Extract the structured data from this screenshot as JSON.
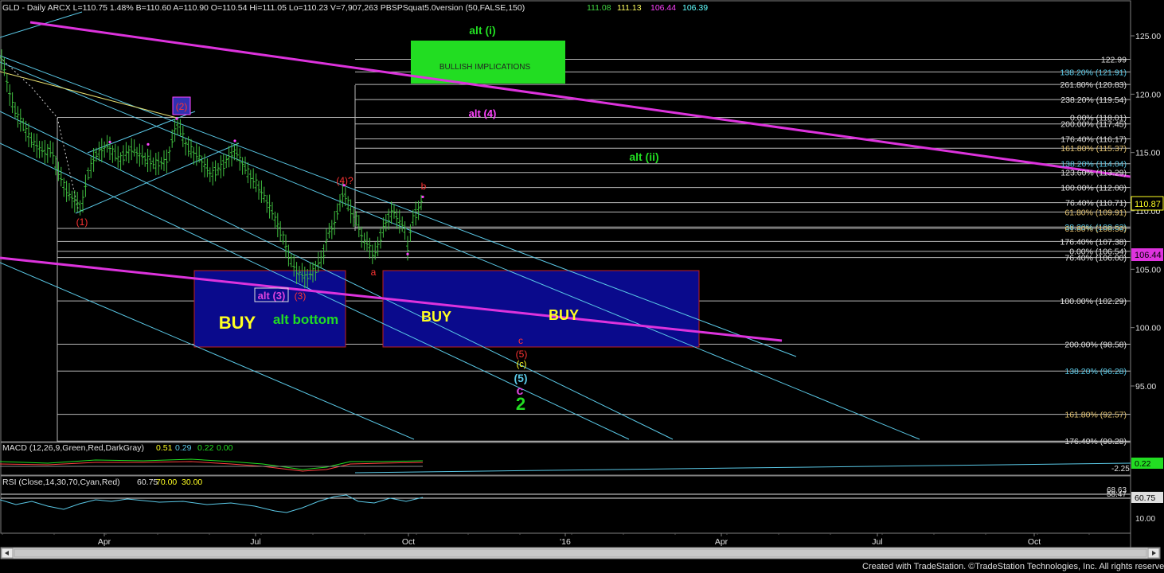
{
  "header": {
    "symbol_text": "GLD - Daily  ARCX  L=110.75  1.48%  B=110.60  A=110.90  O=110.54  Hi=111.05  Lo=110.23  V=7,907,263  PBSPSquat5.0version (50,FALSE,150)",
    "ind_values": [
      "111.08",
      "111.13",
      "106.44",
      "106.39"
    ],
    "ind_colors": [
      "#40d040",
      "#ffff60",
      "#ff40ff",
      "#60ffff"
    ]
  },
  "footer": "Created with TradeStation. ©TradeStation Technologies, Inc. All rights reserved.",
  "colors": {
    "bg": "#000000",
    "border": "#808080",
    "channel": "#5ac8e6",
    "trend": "#dd33dd",
    "fib": "#b8b8b8",
    "price_bar": "#40c040",
    "buy_box": "#0a0a8c",
    "buy_border": "#c02020",
    "bullish_box": "#22dd22"
  },
  "chart_data": {
    "type": "ohlc",
    "symbol": "GLD",
    "interval": "Daily",
    "x_labels": [
      "Apr",
      "Jul",
      "Oct",
      "'16",
      "Apr",
      "Jul",
      "Oct"
    ],
    "ylim": [
      91,
      126.5
    ],
    "y_ticks": [
      "125.00",
      "120.00",
      "115.00",
      "110.00",
      "105.00",
      "100.00",
      "95.00"
    ],
    "last_price_label": "110.87",
    "ma_label": "106.44",
    "price_path": [
      [
        0,
        123.6
      ],
      [
        5,
        122.2
      ],
      [
        15,
        119.2
      ],
      [
        25,
        117.8
      ],
      [
        40,
        116.0
      ],
      [
        55,
        115.0
      ],
      [
        65,
        115.2
      ],
      [
        75,
        113.0
      ],
      [
        85,
        111.5
      ],
      [
        95,
        110.8
      ],
      [
        102,
        110.2
      ],
      [
        110,
        113.0
      ],
      [
        120,
        114.8
      ],
      [
        135,
        115.6
      ],
      [
        150,
        114.4
      ],
      [
        165,
        115.3
      ],
      [
        180,
        114.6
      ],
      [
        195,
        114.0
      ],
      [
        210,
        114.3
      ],
      [
        222,
        117.6
      ],
      [
        235,
        115.5
      ],
      [
        250,
        114.6
      ],
      [
        265,
        113.1
      ],
      [
        280,
        113.9
      ],
      [
        295,
        115.2
      ],
      [
        310,
        113.4
      ],
      [
        325,
        112.0
      ],
      [
        340,
        110.2
      ],
      [
        355,
        107.8
      ],
      [
        362,
        106.3
      ],
      [
        372,
        104.8
      ],
      [
        385,
        104.3
      ],
      [
        395,
        104.9
      ],
      [
        405,
        106.0
      ],
      [
        412,
        108.0
      ],
      [
        420,
        108.9
      ],
      [
        428,
        111.0
      ],
      [
        432,
        111.6
      ],
      [
        440,
        110.0
      ],
      [
        448,
        109.2
      ],
      [
        456,
        107.5
      ],
      [
        464,
        107.0
      ],
      [
        470,
        106.0
      ],
      [
        478,
        107.8
      ],
      [
        486,
        109.2
      ],
      [
        494,
        110.0
      ],
      [
        500,
        109.2
      ],
      [
        508,
        108.6
      ],
      [
        512,
        106.8
      ],
      [
        518,
        109.2
      ],
      [
        524,
        110.0
      ],
      [
        531,
        110.8
      ]
    ],
    "fib_levels": [
      {
        "label": "122.99",
        "value": 122.99,
        "color": "#e0e0e0"
      },
      {
        "label": "138.20% (121.91)",
        "value": 121.91,
        "color": "#5ac8e6"
      },
      {
        "label": "261.80% (120.83)",
        "value": 120.83,
        "color": "#e0e0e0"
      },
      {
        "label": "238.20% (119.54)",
        "value": 119.54,
        "color": "#e0e0e0"
      },
      {
        "label": "0.00% (118.01)",
        "value": 118.01,
        "color": "#e0e0e0"
      },
      {
        "label": "200.00% (117.45)",
        "value": 117.45,
        "color": "#e0e0e0"
      },
      {
        "label": "176.40% (116.17)",
        "value": 116.17,
        "color": "#e0e0e0"
      },
      {
        "label": "161.80% (115.37)",
        "value": 115.37,
        "color": "#e0c070"
      },
      {
        "label": "138.20% (114.04)",
        "value": 114.04,
        "color": "#5ac8e6"
      },
      {
        "label": "123.60% (113.29)",
        "value": 113.29,
        "color": "#e0e0e0"
      },
      {
        "label": "100.00% (112.00)",
        "value": 112.0,
        "color": "#e0e0e0"
      },
      {
        "label": "76.40% (110.71)",
        "value": 110.71,
        "color": "#e0e0e0"
      },
      {
        "label": "61.80% (109.91)",
        "value": 109.91,
        "color": "#e0c070"
      },
      {
        "label": "38.20% (108.62)",
        "value": 108.62,
        "color": "#5ac8e6"
      },
      {
        "label": "61.80% (108.50)",
        "value": 108.5,
        "color": "#e0c070"
      },
      {
        "label": "176.40% (107.38)",
        "value": 107.38,
        "color": "#e0e0e0"
      },
      {
        "label": "0.00% (106.54)",
        "value": 106.54,
        "color": "#e0e0e0"
      },
      {
        "label": "76.40% (106.00)",
        "value": 106.0,
        "color": "#e0e0e0"
      },
      {
        "label": "100.00% (102.29)",
        "value": 102.29,
        "color": "#e0e0e0"
      },
      {
        "label": "200.00% (98.58)",
        "value": 98.58,
        "color": "#e0e0e0"
      },
      {
        "label": "138.20% (96.28)",
        "value": 96.28,
        "color": "#5ac8e6"
      },
      {
        "label": "161.80% (92.57)",
        "value": 92.57,
        "color": "#e0c070"
      },
      {
        "label": "176.40% (90.28)",
        "value": 90.28,
        "color": "#e0e0e0"
      }
    ],
    "annotations": [
      {
        "text": "alt (i)",
        "color": "#22dd22",
        "size": 14
      },
      {
        "text": "BULLISH IMPLICATIONS",
        "color": "#222222",
        "size": 10
      },
      {
        "text": "(2)",
        "color": "#ff3333",
        "size": 12
      },
      {
        "text": "alt (4)",
        "color": "#ff44ff",
        "size": 13
      },
      {
        "text": "alt (ii)",
        "color": "#22dd22",
        "size": 14
      },
      {
        "text": "(4)?",
        "color": "#ff3333",
        "size": 12
      },
      {
        "text": "b",
        "color": "#ff3333",
        "size": 12
      },
      {
        "text": "(1)",
        "color": "#ff3333",
        "size": 12
      },
      {
        "text": "a",
        "color": "#ff3333",
        "size": 12
      },
      {
        "text": "alt (3)",
        "color": "#dd44dd",
        "size": 13
      },
      {
        "text": "(3)",
        "color": "#ff3333",
        "size": 12
      },
      {
        "text": "BUY",
        "color": "#ffff22",
        "size": 22
      },
      {
        "text": "alt bottom",
        "color": "#22dd22",
        "size": 17
      },
      {
        "text": "BUY",
        "color": "#ffff22",
        "size": 18
      },
      {
        "text": "BUY",
        "color": "#ffff22",
        "size": 18
      },
      {
        "text": "c",
        "color": "#ff3333",
        "size": 12
      },
      {
        "text": "(5)",
        "color": "#ff3333",
        "size": 12
      },
      {
        "text": "(c)",
        "color": "#ffff22",
        "size": 11
      },
      {
        "text": "(5)",
        "color": "#5ac8e6",
        "size": 14
      },
      {
        "text": "c",
        "color": "#dd44dd",
        "size": 16
      },
      {
        "text": "2",
        "color": "#22dd22",
        "size": 22
      }
    ],
    "macd": {
      "label": "MACD (12,26,9,Green,Red,DarkGray)",
      "values": [
        "0.51",
        "0.29",
        "0.22",
        "0.00"
      ],
      "value_colors": [
        "#ffff22",
        "#5ac8e6",
        "#22dd22",
        "#22dd22"
      ],
      "right_tag": "0.22",
      "axis_label": "-2.25"
    },
    "rsi": {
      "label": "RSI (Close,14,30,70,Cyan,Red)",
      "values": [
        "60.75",
        "70.00",
        "30.00"
      ],
      "value_colors": [
        "#e0e0e0",
        "#ffff22",
        "#ffff22"
      ],
      "right_tag": "60.75",
      "axis_labels": [
        "68.63",
        "58.47",
        "10.00"
      ]
    }
  }
}
